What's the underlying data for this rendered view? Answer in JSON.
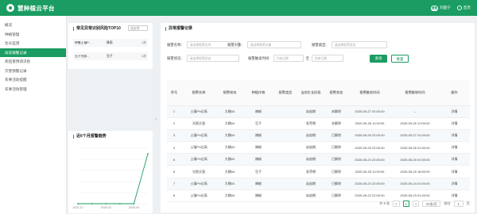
{
  "app": {
    "title": "慧种植云平台",
    "user_badge": "管理",
    "user": "刘国宁",
    "home": "首页"
  },
  "sidebar": {
    "items": [
      {
        "label": "概况"
      },
      {
        "label": "种植管理"
      },
      {
        "label": "生长监测"
      },
      {
        "label": "异常报警记录",
        "active": true
      },
      {
        "label": "病虫害预测识别"
      },
      {
        "label": "灾害预警记录"
      },
      {
        "label": "农事活动提醒"
      },
      {
        "label": "农事活动管理"
      }
    ]
  },
  "top10": {
    "title": "常见异常识别风险TOP10",
    "select_placeholder": "请选择",
    "rows": [
      {
        "name": "种植土壤P...",
        "type": "降雨",
        "count": "1次"
      },
      {
        "name": "豆子光照...",
        "type": "豆子",
        "count": "3次"
      }
    ]
  },
  "trend": {
    "title": "近6个月报警趋势"
  },
  "chart_data": {
    "type": "line",
    "title": "近6个月报警趋势",
    "categories": [
      "2024-12",
      "2025-01",
      "2025-02",
      "2025-03",
      "2025-04",
      "2025-05"
    ],
    "series": [
      {
        "values": [
          0,
          0,
          0,
          0,
          0,
          9
        ]
      }
    ],
    "x_tick_labels": [
      "2024-12",
      "2025-02",
      "2025-04"
    ],
    "grid": true,
    "line_color": "#1a9c62"
  },
  "main": {
    "title": "异常报警记录",
    "filters": {
      "alarm_name_label": "报警名称:",
      "alarm_name_placeholder": "请选择报警名称",
      "alarm_object_label": "报警对象:",
      "alarm_object_placeholder": "请选择报警对象",
      "alarm_type_label": "报警类型:",
      "alarm_type_placeholder": "请选择报警类型",
      "alarm_status_label": "报警状态:",
      "alarm_status_placeholder": "请选择报警状态",
      "alarm_time_label": "报警触发时间:",
      "start_placeholder": "开始日期",
      "date_sep": "至",
      "end_placeholder": "结束日期",
      "query_button": "查询",
      "reset_button": "重置"
    },
    "columns": [
      "序号",
      "报警名称",
      "报警地块",
      "种植作物",
      "报警类型",
      "当前生长阶段",
      "报警状态",
      "报警触发时间",
      "报警解除时间",
      "操作"
    ],
    "rows": [
      {
        "no": "1",
        "name": "土壤PH过高",
        "plot": "大棚#3",
        "crop": "辣椒",
        "type": "",
        "stage": "幼苗期",
        "status": "未解除",
        "status_kind": "red",
        "trigger": "2025-05-27 02:00:00",
        "release": "--",
        "op": "详情"
      },
      {
        "no": "2",
        "name": "光照太强",
        "plot": "大棚#4",
        "crop": "豆子",
        "type": "",
        "stage": "发芽期",
        "status": "未解除",
        "status_kind": "red",
        "trigger": "2025-05-26 11:00:00",
        "release": "2025-05-26 12:00:00",
        "op": "详情"
      },
      {
        "no": "3",
        "name": "土壤PH过高",
        "plot": "大棚#3",
        "crop": "辣椒",
        "type": "",
        "stage": "幼苗期",
        "status": "已解除",
        "status_kind": "green",
        "trigger": "2025-05-26 22:00:00",
        "release": "2025-05-27 01:00:00",
        "op": "详情"
      },
      {
        "no": "4",
        "name": "土壤PH过高",
        "plot": "大棚#3",
        "crop": "辣椒",
        "type": "",
        "stage": "幼苗期",
        "status": "已解除",
        "status_kind": "green",
        "trigger": "2025-05-25 22:00:00",
        "release": "2025-05-26 01:00:00",
        "op": "详情"
      },
      {
        "no": "5",
        "name": "土壤PH过高",
        "plot": "大棚#3",
        "crop": "辣椒",
        "type": "",
        "stage": "幼苗期",
        "status": "已解除",
        "status_kind": "green",
        "trigger": "2025-05-24 22:00:00",
        "release": "2025-05-25 01:00:00",
        "op": "详情"
      },
      {
        "no": "6",
        "name": "光照太强",
        "plot": "大棚#4",
        "crop": "豆子",
        "type": "",
        "stage": "发芽期",
        "status": "已解除",
        "status_kind": "green",
        "trigger": "2025-05-25 11:00:00",
        "release": "2025-05-25 16:00:00",
        "op": "详情"
      },
      {
        "no": "7",
        "name": "土壤PH过高",
        "plot": "大棚#3",
        "crop": "辣椒",
        "type": "",
        "stage": "幼苗期",
        "status": "已解除",
        "status_kind": "green",
        "trigger": "2025-05-23 22:00:00",
        "release": "2025-05-24 01:00:00",
        "op": "详情"
      },
      {
        "no": "8",
        "name": "土壤PH过高",
        "plot": "大棚#3",
        "crop": "辣椒",
        "type": "",
        "stage": "幼苗期",
        "status": "已解除",
        "status_kind": "green",
        "trigger": "2025-05-22 22:00:00",
        "release": "2025-05-23 01:00:00",
        "op": "详情"
      }
    ],
    "pager": {
      "total": "共 9 条",
      "prev": "<",
      "current": "1",
      "next": ">",
      "size": "20条/页",
      "goto": "前往",
      "goto_value": "1",
      "page_unit": "页"
    }
  },
  "colors": {
    "brand": "#1a9c62",
    "danger": "#e55353"
  }
}
